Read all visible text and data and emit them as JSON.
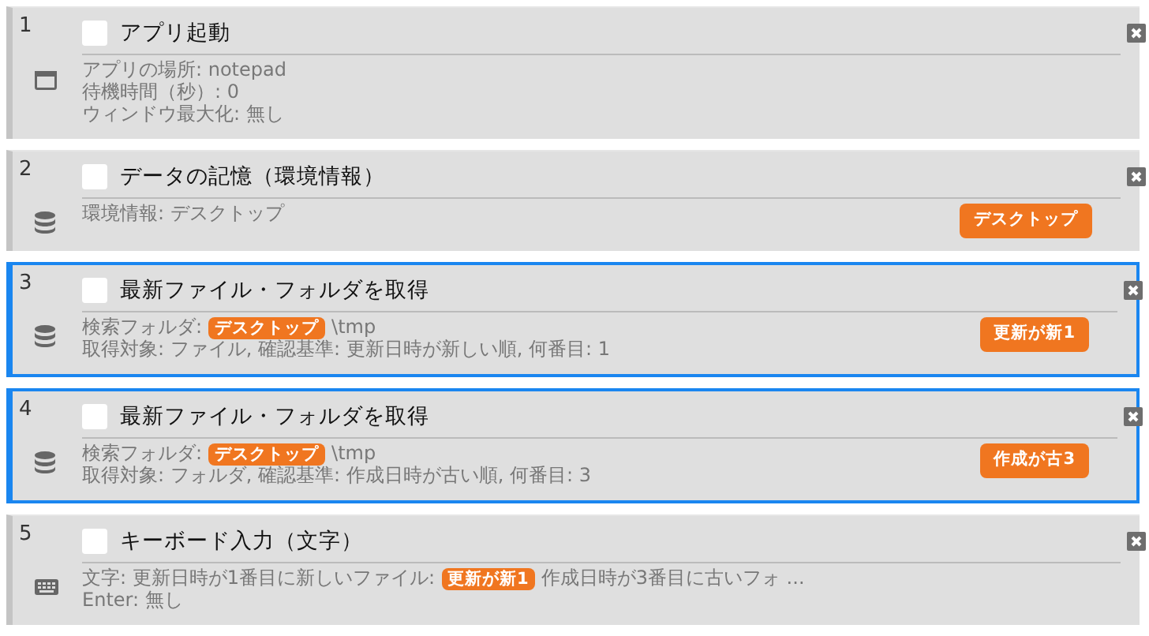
{
  "steps": [
    {
      "number": "1",
      "kind": "app",
      "selected": false,
      "checked": false,
      "title": "アプリ起動",
      "lines": [
        [
          {
            "kind": "text",
            "text": "アプリの場所: notepad"
          }
        ],
        [
          {
            "kind": "text",
            "text": "待機時間（秒）: 0"
          }
        ],
        [
          {
            "kind": "text",
            "text": "ウィンドウ最大化: 無し"
          }
        ]
      ]
    },
    {
      "number": "2",
      "kind": "data",
      "selected": false,
      "checked": false,
      "title": "データの記憶（環境情報）",
      "lines": [
        [
          {
            "kind": "text",
            "text": "環境情報: デスクトップ"
          }
        ]
      ],
      "badge": "デスクトップ"
    },
    {
      "number": "3",
      "kind": "data",
      "selected": true,
      "checked": false,
      "title": "最新ファイル・フォルダを取得",
      "lines": [
        [
          {
            "kind": "text",
            "text": "検索フォルダ:"
          },
          {
            "kind": "tag",
            "text": "デスクトップ"
          },
          {
            "kind": "text",
            "text": "\\tmp"
          }
        ],
        [
          {
            "kind": "text",
            "text": "取得対象: ファイル, 確認基準: 更新日時が新しい順, 何番目: 1"
          }
        ]
      ],
      "badge": "更新が新1"
    },
    {
      "number": "4",
      "kind": "data",
      "selected": true,
      "checked": false,
      "title": "最新ファイル・フォルダを取得",
      "lines": [
        [
          {
            "kind": "text",
            "text": "検索フォルダ:"
          },
          {
            "kind": "tag",
            "text": "デスクトップ"
          },
          {
            "kind": "text",
            "text": "\\tmp"
          }
        ],
        [
          {
            "kind": "text",
            "text": "取得対象: フォルダ, 確認基準: 作成日時が古い順, 何番目: 3"
          }
        ]
      ],
      "badge": "作成が古3"
    },
    {
      "number": "5",
      "kind": "keyboard",
      "selected": false,
      "checked": false,
      "title": "キーボード入力（文字）",
      "lines": [
        [
          {
            "kind": "text",
            "text": "文字: 更新日時が1番目に新しいファイル:"
          },
          {
            "kind": "tag",
            "text": "更新が新1"
          },
          {
            "kind": "text",
            "text": "作成日時が3番目に古いフォ ..."
          }
        ],
        [
          {
            "kind": "text",
            "text": "Enter: 無し"
          }
        ]
      ]
    }
  ]
}
